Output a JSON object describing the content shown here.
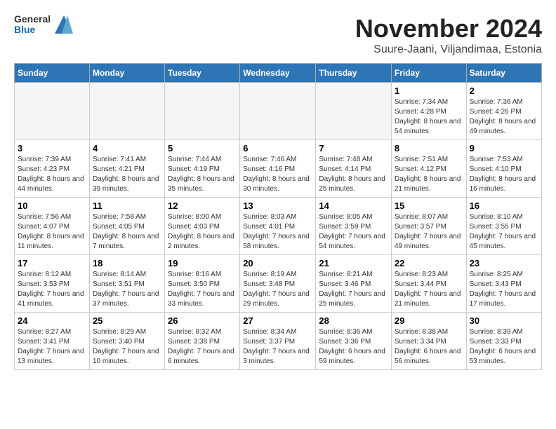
{
  "logo": {
    "general": "General",
    "blue": "Blue"
  },
  "header": {
    "title": "November 2024",
    "subtitle": "Suure-Jaani, Viljandimaa, Estonia"
  },
  "weekdays": [
    "Sunday",
    "Monday",
    "Tuesday",
    "Wednesday",
    "Thursday",
    "Friday",
    "Saturday"
  ],
  "weeks": [
    [
      {
        "day": "",
        "empty": true
      },
      {
        "day": "",
        "empty": true
      },
      {
        "day": "",
        "empty": true
      },
      {
        "day": "",
        "empty": true
      },
      {
        "day": "",
        "empty": true
      },
      {
        "day": "1",
        "sunrise": "Sunrise: 7:34 AM",
        "sunset": "Sunset: 4:28 PM",
        "daylight": "Daylight: 8 hours and 54 minutes."
      },
      {
        "day": "2",
        "sunrise": "Sunrise: 7:36 AM",
        "sunset": "Sunset: 4:26 PM",
        "daylight": "Daylight: 8 hours and 49 minutes."
      }
    ],
    [
      {
        "day": "3",
        "sunrise": "Sunrise: 7:39 AM",
        "sunset": "Sunset: 4:23 PM",
        "daylight": "Daylight: 8 hours and 44 minutes."
      },
      {
        "day": "4",
        "sunrise": "Sunrise: 7:41 AM",
        "sunset": "Sunset: 4:21 PM",
        "daylight": "Daylight: 8 hours and 39 minutes."
      },
      {
        "day": "5",
        "sunrise": "Sunrise: 7:44 AM",
        "sunset": "Sunset: 4:19 PM",
        "daylight": "Daylight: 8 hours and 35 minutes."
      },
      {
        "day": "6",
        "sunrise": "Sunrise: 7:46 AM",
        "sunset": "Sunset: 4:16 PM",
        "daylight": "Daylight: 8 hours and 30 minutes."
      },
      {
        "day": "7",
        "sunrise": "Sunrise: 7:48 AM",
        "sunset": "Sunset: 4:14 PM",
        "daylight": "Daylight: 8 hours and 25 minutes."
      },
      {
        "day": "8",
        "sunrise": "Sunrise: 7:51 AM",
        "sunset": "Sunset: 4:12 PM",
        "daylight": "Daylight: 8 hours and 21 minutes."
      },
      {
        "day": "9",
        "sunrise": "Sunrise: 7:53 AM",
        "sunset": "Sunset: 4:10 PM",
        "daylight": "Daylight: 8 hours and 16 minutes."
      }
    ],
    [
      {
        "day": "10",
        "sunrise": "Sunrise: 7:56 AM",
        "sunset": "Sunset: 4:07 PM",
        "daylight": "Daylight: 8 hours and 11 minutes."
      },
      {
        "day": "11",
        "sunrise": "Sunrise: 7:58 AM",
        "sunset": "Sunset: 4:05 PM",
        "daylight": "Daylight: 8 hours and 7 minutes."
      },
      {
        "day": "12",
        "sunrise": "Sunrise: 8:00 AM",
        "sunset": "Sunset: 4:03 PM",
        "daylight": "Daylight: 8 hours and 2 minutes."
      },
      {
        "day": "13",
        "sunrise": "Sunrise: 8:03 AM",
        "sunset": "Sunset: 4:01 PM",
        "daylight": "Daylight: 7 hours and 58 minutes."
      },
      {
        "day": "14",
        "sunrise": "Sunrise: 8:05 AM",
        "sunset": "Sunset: 3:59 PM",
        "daylight": "Daylight: 7 hours and 54 minutes."
      },
      {
        "day": "15",
        "sunrise": "Sunrise: 8:07 AM",
        "sunset": "Sunset: 3:57 PM",
        "daylight": "Daylight: 7 hours and 49 minutes."
      },
      {
        "day": "16",
        "sunrise": "Sunrise: 8:10 AM",
        "sunset": "Sunset: 3:55 PM",
        "daylight": "Daylight: 7 hours and 45 minutes."
      }
    ],
    [
      {
        "day": "17",
        "sunrise": "Sunrise: 8:12 AM",
        "sunset": "Sunset: 3:53 PM",
        "daylight": "Daylight: 7 hours and 41 minutes."
      },
      {
        "day": "18",
        "sunrise": "Sunrise: 8:14 AM",
        "sunset": "Sunset: 3:51 PM",
        "daylight": "Daylight: 7 hours and 37 minutes."
      },
      {
        "day": "19",
        "sunrise": "Sunrise: 8:16 AM",
        "sunset": "Sunset: 3:50 PM",
        "daylight": "Daylight: 7 hours and 33 minutes."
      },
      {
        "day": "20",
        "sunrise": "Sunrise: 8:19 AM",
        "sunset": "Sunset: 3:48 PM",
        "daylight": "Daylight: 7 hours and 29 minutes."
      },
      {
        "day": "21",
        "sunrise": "Sunrise: 8:21 AM",
        "sunset": "Sunset: 3:46 PM",
        "daylight": "Daylight: 7 hours and 25 minutes."
      },
      {
        "day": "22",
        "sunrise": "Sunrise: 8:23 AM",
        "sunset": "Sunset: 3:44 PM",
        "daylight": "Daylight: 7 hours and 21 minutes."
      },
      {
        "day": "23",
        "sunrise": "Sunrise: 8:25 AM",
        "sunset": "Sunset: 3:43 PM",
        "daylight": "Daylight: 7 hours and 17 minutes."
      }
    ],
    [
      {
        "day": "24",
        "sunrise": "Sunrise: 8:27 AM",
        "sunset": "Sunset: 3:41 PM",
        "daylight": "Daylight: 7 hours and 13 minutes."
      },
      {
        "day": "25",
        "sunrise": "Sunrise: 8:29 AM",
        "sunset": "Sunset: 3:40 PM",
        "daylight": "Daylight: 7 hours and 10 minutes."
      },
      {
        "day": "26",
        "sunrise": "Sunrise: 8:32 AM",
        "sunset": "Sunset: 3:38 PM",
        "daylight": "Daylight: 7 hours and 6 minutes."
      },
      {
        "day": "27",
        "sunrise": "Sunrise: 8:34 AM",
        "sunset": "Sunset: 3:37 PM",
        "daylight": "Daylight: 7 hours and 3 minutes."
      },
      {
        "day": "28",
        "sunrise": "Sunrise: 8:36 AM",
        "sunset": "Sunset: 3:36 PM",
        "daylight": "Daylight: 6 hours and 59 minutes."
      },
      {
        "day": "29",
        "sunrise": "Sunrise: 8:38 AM",
        "sunset": "Sunset: 3:34 PM",
        "daylight": "Daylight: 6 hours and 56 minutes."
      },
      {
        "day": "30",
        "sunrise": "Sunrise: 8:39 AM",
        "sunset": "Sunset: 3:33 PM",
        "daylight": "Daylight: 6 hours and 53 minutes."
      }
    ]
  ]
}
